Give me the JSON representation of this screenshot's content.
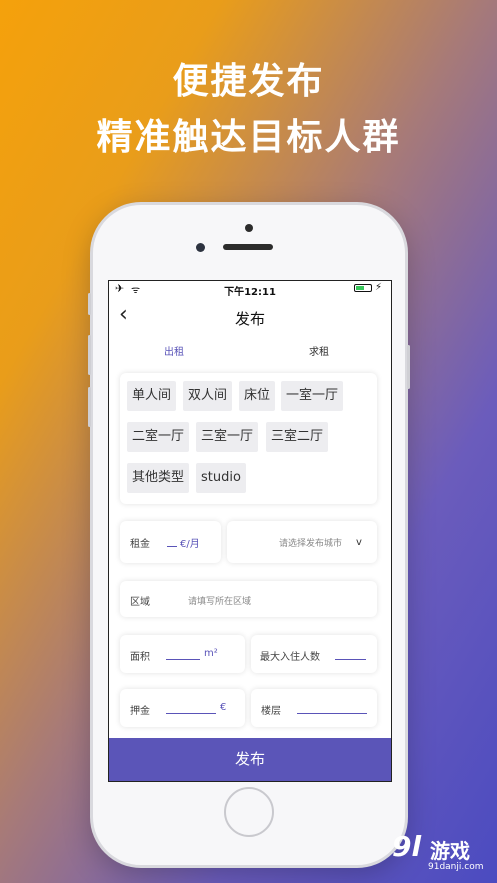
{
  "promo": {
    "line1": "便捷发布",
    "line2": "精准触达目标人群"
  },
  "status_bar": {
    "time": "下午12:11",
    "airplane_icon": "✈",
    "wifi_icon": "ᯤ",
    "charging_icon": "⚡"
  },
  "nav": {
    "back_icon": "‹",
    "title": "发布"
  },
  "tabs": [
    {
      "label": "出租",
      "active": true
    },
    {
      "label": "求租",
      "active": false
    }
  ],
  "room_types": [
    "单人间",
    "双人间",
    "床位",
    "一室一厅",
    "二室一厅",
    "三室一厅",
    "三室二厅",
    "其他类型",
    "studio"
  ],
  "form": {
    "rent": {
      "label": "租金",
      "unit": "€/月"
    },
    "city": {
      "placeholder": "请选择发布城市",
      "chevron": "v"
    },
    "district": {
      "label": "区域",
      "placeholder": "请填写所在区域"
    },
    "area": {
      "label": "面积",
      "unit": "m²"
    },
    "max_occupants": {
      "label": "最大入住人数"
    },
    "deposit": {
      "label": "押金",
      "unit": "€"
    },
    "floor": {
      "label": "楼层"
    }
  },
  "publish_label": "发布",
  "watermark": {
    "logo": "9l",
    "name": "游戏",
    "url": "91danji.com"
  },
  "colors": {
    "accent": "#5b55b8",
    "gradient_start": "#f5a10b",
    "gradient_end": "#4b4bc0"
  }
}
